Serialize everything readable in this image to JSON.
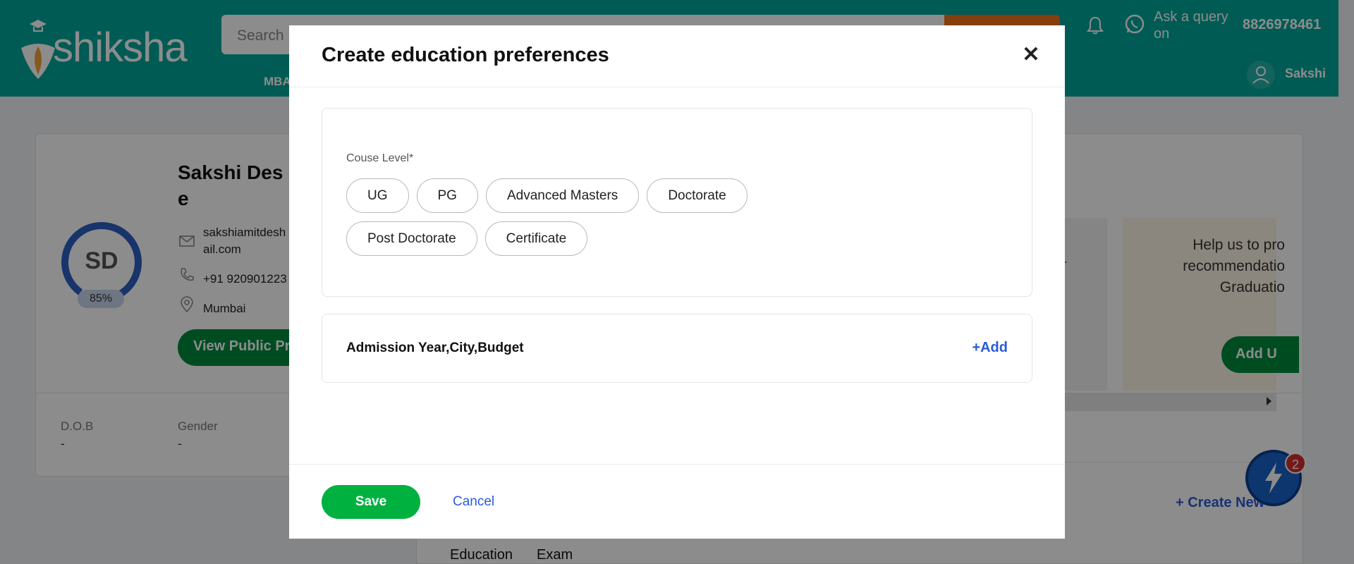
{
  "header": {
    "logo_text": "shiksha",
    "search_placeholder": "Search",
    "nav_first": "MBA",
    "ask_query": "Ask a query on",
    "phone": "8826978461",
    "user_name": "Sakshi"
  },
  "profile": {
    "name": "Sakshi Des e",
    "initials": "SD",
    "completion": "85%",
    "email": "sakshiamitdesh ail.com",
    "phone": "+91 920901223",
    "city": "Mumbai",
    "view_public_label": "View Public Pr",
    "dob_label": "D.O.B",
    "dob_value": "-",
    "gender_label": "Gender",
    "gender_value": "-"
  },
  "recommendation": {
    "text": "Help us to pro recommendatio Graduatio",
    "button_label": "Add U",
    "side_fragment": "r"
  },
  "lower": {
    "create_new": "+ Create New",
    "tab_education": "Education",
    "tab_exam": "Exam"
  },
  "notification_badge": "2",
  "modal": {
    "title": "Create education preferences",
    "close_glyph": "✕",
    "course_level_label": "Couse Level*",
    "course_levels": [
      "UG",
      "PG",
      "Advanced Masters",
      "Doctorate",
      "Post Doctorate",
      "Certificate"
    ],
    "admission_title": "Admission Year,City,Budget",
    "admission_add": "+Add",
    "save_label": "Save",
    "cancel_label": "Cancel"
  },
  "colors": {
    "header_bg": "#00a69c",
    "accent_green": "#00b140",
    "link_blue": "#2a5bd7",
    "search_btn": "#f47216"
  }
}
